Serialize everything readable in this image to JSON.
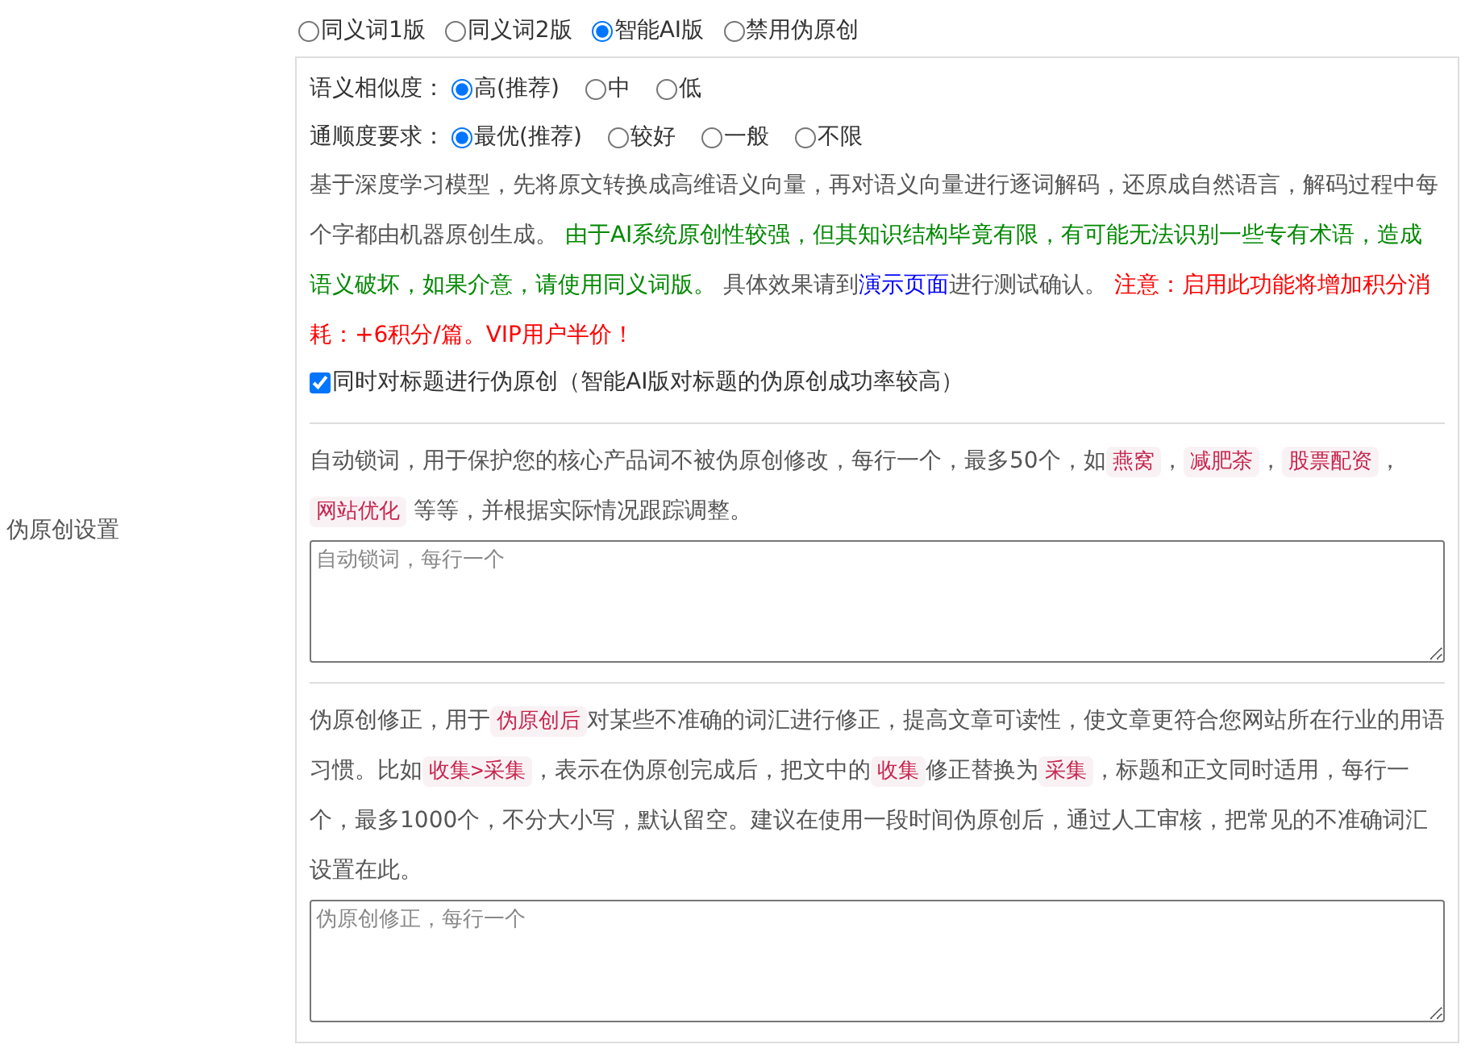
{
  "sidebar_label": "伪原创设置",
  "mode_options": [
    {
      "label": "同义词1版",
      "selected": false
    },
    {
      "label": "同义词2版",
      "selected": false
    },
    {
      "label": "智能AI版",
      "selected": true
    },
    {
      "label": "禁用伪原创",
      "selected": false
    }
  ],
  "settings_box": {
    "option_groups": [
      {
        "label": "语义相似度：",
        "options": [
          {
            "label": "高(推荐)",
            "selected": true
          },
          {
            "label": "中",
            "selected": false
          },
          {
            "label": "低",
            "selected": false
          }
        ]
      },
      {
        "label": "通顺度要求：",
        "options": [
          {
            "label": "最优(推荐)",
            "selected": true
          },
          {
            "label": "较好",
            "selected": false
          },
          {
            "label": "一般",
            "selected": false
          },
          {
            "label": "不限",
            "selected": false
          }
        ]
      }
    ],
    "description": [
      {
        "kind": "text",
        "text": "基于深度学习模型，先将原文转换成高维语义向量，再对语义向量进行逐词解码，还原成自然语言，解码过程中每个字都由机器原创生成。 "
      },
      {
        "kind": "note",
        "text": "由于AI系统原创性较强，但其知识结构毕竟有限，有可能无法识别一些专有术语，造成语义破坏，如果介意，请使用同义词版。"
      },
      {
        "kind": "text",
        "text": " 具体效果请到"
      },
      {
        "kind": "link",
        "text": "演示页面"
      },
      {
        "kind": "text",
        "text": "进行测试确认。 "
      },
      {
        "kind": "warning",
        "text": "注意：启用此功能将增加积分消耗：+6积分/篇。VIP用户半价！"
      }
    ],
    "title_option": {
      "label": "同时对标题进行伪原创（智能AI版对标题的伪原创成功率较高）",
      "checked": true
    },
    "lock_words": {
      "description": [
        {
          "kind": "text",
          "text": "自动锁词，用于保护您的核心产品词不被伪原创修改，每行一个，最多50个，如"
        },
        {
          "kind": "code",
          "text": "燕窝"
        },
        {
          "kind": "text",
          "text": "，"
        },
        {
          "kind": "code",
          "text": "减肥茶"
        },
        {
          "kind": "text",
          "text": "，"
        },
        {
          "kind": "code",
          "text": "股票配资"
        },
        {
          "kind": "text",
          "text": "，"
        },
        {
          "kind": "code",
          "text": "网站优化"
        },
        {
          "kind": "text",
          "text": " 等等，并根据实际情况跟踪调整。"
        }
      ],
      "placeholder": "自动锁词，每行一个"
    },
    "corrections": {
      "description": [
        {
          "kind": "text",
          "text": "伪原创修正，用于"
        },
        {
          "kind": "code",
          "text": "伪原创后"
        },
        {
          "kind": "text",
          "text": "对某些不准确的词汇进行修正，提高文章可读性，使文章更符合您网站所在行业的用语习惯。比如"
        },
        {
          "kind": "code",
          "text": "收集>采集"
        },
        {
          "kind": "text",
          "text": "，表示在伪原创完成后，把文中的"
        },
        {
          "kind": "code",
          "text": "收集"
        },
        {
          "kind": "text",
          "text": "修正替换为"
        },
        {
          "kind": "code",
          "text": "采集"
        },
        {
          "kind": "text",
          "text": "，标题和正文同时适用，每行一个，最多1000个，不分大小写，默认留空。建议在使用一段时间伪原创后，通过人工审核，把常见的不准确词汇设置在此。"
        }
      ],
      "placeholder": "伪原创修正，每行一个"
    }
  }
}
